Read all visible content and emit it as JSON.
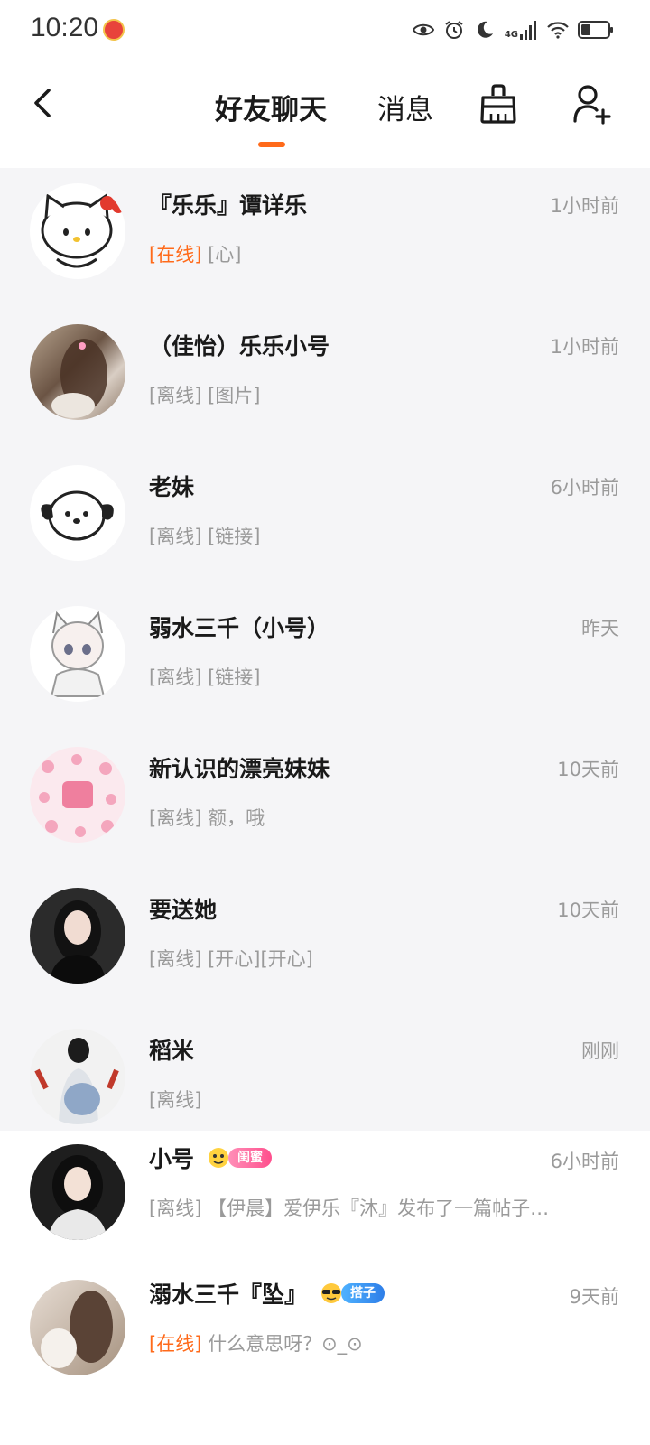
{
  "status_bar": {
    "time": "10:20",
    "network": "4G",
    "icons": [
      "eye-icon",
      "alarm-icon",
      "moon-icon",
      "signal-icon",
      "wifi-icon",
      "battery-icon"
    ]
  },
  "header": {
    "tabs": [
      {
        "label": "好友聊天",
        "active": true
      },
      {
        "label": "消息",
        "active": false
      }
    ],
    "accent_color": "#ff6a1a"
  },
  "conversations": [
    {
      "name": "『乐乐』谭详乐",
      "time": "1小时前",
      "status": "[在线]",
      "message": "[心]",
      "online": true
    },
    {
      "name": "（佳怡）乐乐小号",
      "time": "1小时前",
      "status": "[离线]",
      "message": "[图片]",
      "online": false
    },
    {
      "name": "老妹",
      "time": "6小时前",
      "status": "[离线]",
      "message": "[链接]",
      "online": false
    },
    {
      "name": "弱水三千（小号）",
      "time": "昨天",
      "status": "[离线]",
      "message": "[链接]",
      "online": false
    },
    {
      "name": "新认识的漂亮妹妹",
      "time": "10天前",
      "status": "[离线]",
      "message": "额，哦",
      "online": false
    },
    {
      "name": "要送她",
      "time": "10天前",
      "status": "[离线]",
      "message": "[开心][开心]",
      "online": false
    },
    {
      "name": "稻米",
      "time": "刚刚",
      "status": "[离线]",
      "message": "",
      "online": false
    },
    {
      "name": "小号",
      "time": "6小时前",
      "status": "[离线]",
      "message": "【伊晨】爱伊乐『沐』发布了一篇帖子…",
      "online": false,
      "badge": "闺蜜"
    },
    {
      "name": "溺水三千『坠』",
      "time": "9天前",
      "status": "[在线]",
      "message": "什么意思呀？⊙_⊙",
      "online": true,
      "badge": "搭子"
    }
  ]
}
